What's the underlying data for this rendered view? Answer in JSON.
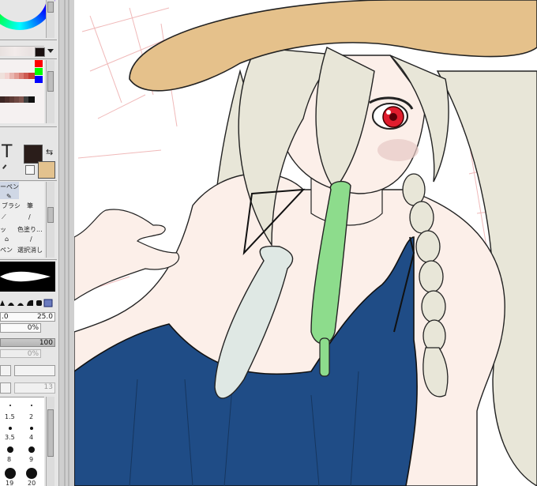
{
  "left_panel": {
    "color_wheel": {
      "icon": "color-wheel"
    },
    "palette": {
      "colors": [
        "#efe1dc",
        "#f3d3d0",
        "#e9b6b0",
        "#e39c94",
        "#d97b72",
        "#ce5b52",
        "#c43c33",
        "#3b2523",
        "#4c2f2b",
        "#5e3b36",
        "#6f4842",
        "#80554e",
        "#3f3f3f",
        "#101010"
      ],
      "accent_colors": [
        "#ff0000",
        "#00ff00",
        "#0000ff"
      ],
      "scroll_icon": "scroll-arrow"
    },
    "text_tool_label": "T",
    "primary_color": "#2a1d1a",
    "secondary_color": "#e3c28e",
    "brushes": {
      "items": [
        {
          "label": "ーペン",
          "icon": "pen-icon"
        },
        {
          "label": "ブラシ",
          "icon": "brush-icon"
        },
        {
          "label": "筆",
          "icon": "calligraphy-brush-icon"
        },
        {
          "label": "ッ",
          "icon": "marker-icon"
        },
        {
          "label": "色塗り...",
          "icon": "fill-brush-icon"
        },
        {
          "label": "ペン",
          "icon": "pen-icon"
        },
        {
          "label": "選択消し",
          "icon": "eraser-icon"
        }
      ]
    },
    "size_value": ".0",
    "size_max": "25.0",
    "density_label": "0%",
    "blend_value": "100",
    "blend_label": "0%",
    "blur_value": "13",
    "brush_sizes": [
      "1.5",
      "2",
      "3.5",
      "4",
      "8",
      "9",
      "19",
      "20"
    ]
  },
  "canvas": {
    "title": "illustration-canvas"
  }
}
